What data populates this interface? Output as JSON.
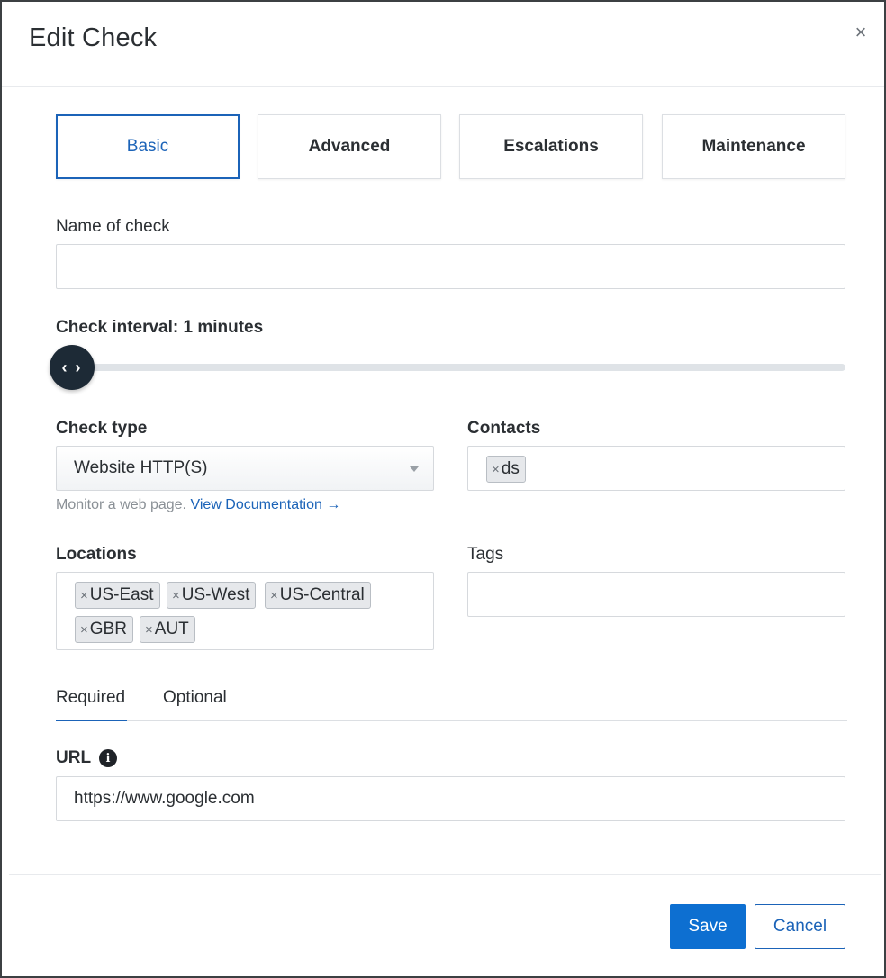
{
  "dialog": {
    "title": "Edit Check",
    "close_label": "×"
  },
  "tabs": [
    {
      "label": "Basic",
      "active": true
    },
    {
      "label": "Advanced",
      "active": false
    },
    {
      "label": "Escalations",
      "active": false
    },
    {
      "label": "Maintenance",
      "active": false
    }
  ],
  "form": {
    "name_label": "Name of check",
    "name_value": "",
    "interval_label": "Check interval: 1 minutes",
    "interval_value": 1,
    "slider_handle_icon": "‹ ›",
    "check_type_label": "Check type",
    "check_type_value": "Website HTTP(S)",
    "check_type_help": "Monitor a web page.",
    "docs_link": "View Documentation →",
    "contacts_label": "Contacts",
    "contacts": [
      "ds"
    ],
    "locations_label": "Locations",
    "locations": [
      "US-East",
      "US-West",
      "US-Central",
      "GBR",
      "AUT"
    ],
    "tags_label": "Tags",
    "tags": []
  },
  "subtabs": [
    {
      "label": "Required",
      "active": true
    },
    {
      "label": "Optional",
      "active": false
    }
  ],
  "url": {
    "label": "URL",
    "info_icon": "i",
    "value": "https://www.google.com"
  },
  "footer": {
    "save_label": "Save",
    "cancel_label": "Cancel"
  },
  "chip_remove": "×",
  "colors": {
    "accent": "#1b63b8",
    "primary_button": "#0d6fd1",
    "slider_handle": "#1d2a36"
  }
}
